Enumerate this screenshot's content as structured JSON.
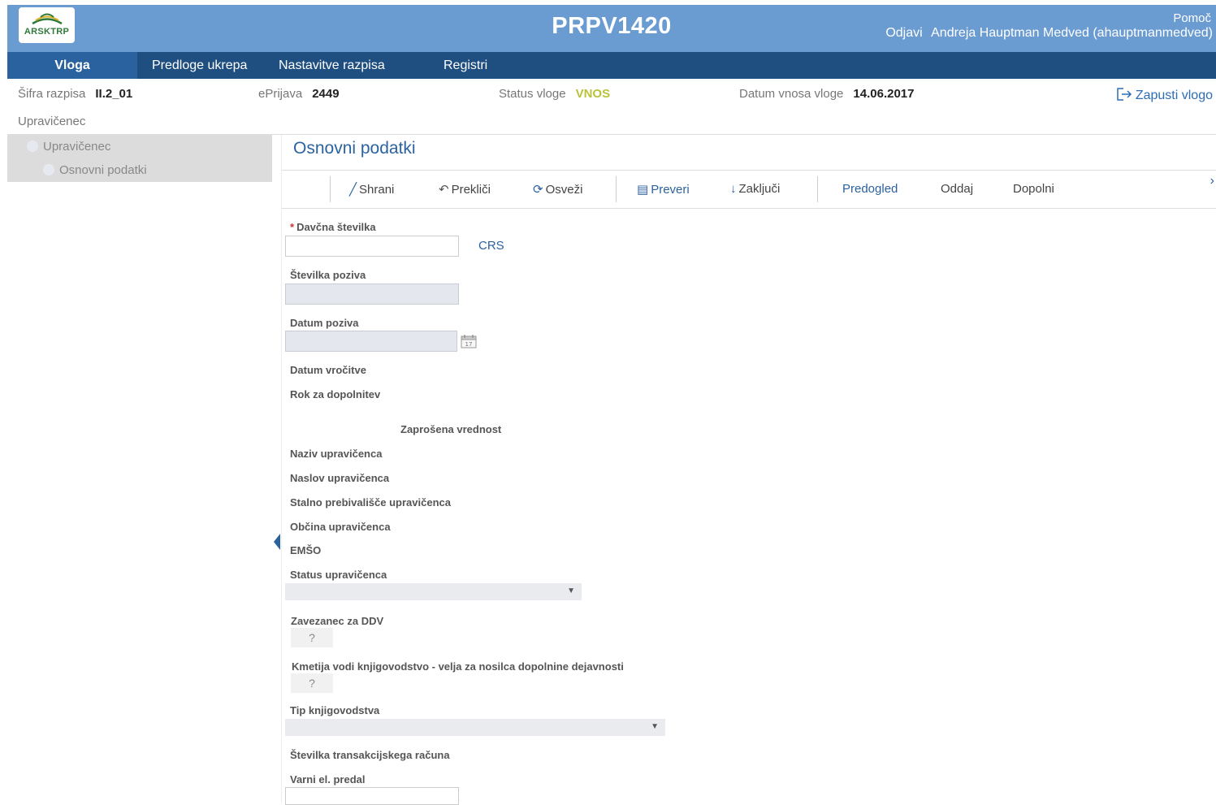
{
  "header": {
    "logo_text": "ARSKTRP",
    "title": "PRPV1420",
    "help": "Pomoč",
    "logout": "Odjavi",
    "user": "Andreja Hauptman Medved (ahauptmanmedved)"
  },
  "nav": [
    "Vloga",
    "Predloge ukrepa",
    "Nastavitve razpisa",
    "Registri"
  ],
  "info": {
    "sifra_label": "Šifra razpisa",
    "sifra_value": "II.2_01",
    "eprijava_label": "ePrijava",
    "eprijava_value": "2449",
    "status_label": "Status vloge",
    "status_value": "VNOS",
    "datum_label": "Datum vnosa vloge",
    "datum_value": "14.06.2017",
    "exit": "Zapusti vlogo"
  },
  "section_label": "Upravičenec",
  "sidebar": {
    "parent": "Upravičenec",
    "child": "Osnovni podatki"
  },
  "page_title": "Osnovni podatki",
  "toolbar": {
    "save": "Shrani",
    "cancel": "Prekliči",
    "refresh": "Osveži",
    "check": "Preveri",
    "close": "Zaključi",
    "preview": "Predogled",
    "submit": "Oddaj",
    "supplement": "Dopolni"
  },
  "form": {
    "davcna": "Davčna številka",
    "crs": "CRS",
    "stevilka_poziva": "Številka poziva",
    "datum_poziva": "Datum poziva",
    "datum_vrocitve": "Datum vročitve",
    "rok": "Rok za dopolnitev",
    "zaprosena": "Zaprošena vrednost",
    "naziv": "Naziv upravičenca",
    "naslov": "Naslov upravičenca",
    "prebivalisce": "Stalno prebivališče upravičenca",
    "obcina": "Občina upravičenca",
    "emso": "EMŠO",
    "status": "Status upravičenca",
    "ddv": "Zavezanec za DDV",
    "ddv_value": "?",
    "knjigovodstvo": "Kmetija vodi knjigovodstvo - velja za nosilca dopolnine dejavnosti",
    "knjigovodstvo_value": "?",
    "tip": "Tip knjigovodstva",
    "trr": "Številka transakcijskega računa",
    "predal": "Varni el. predal"
  }
}
